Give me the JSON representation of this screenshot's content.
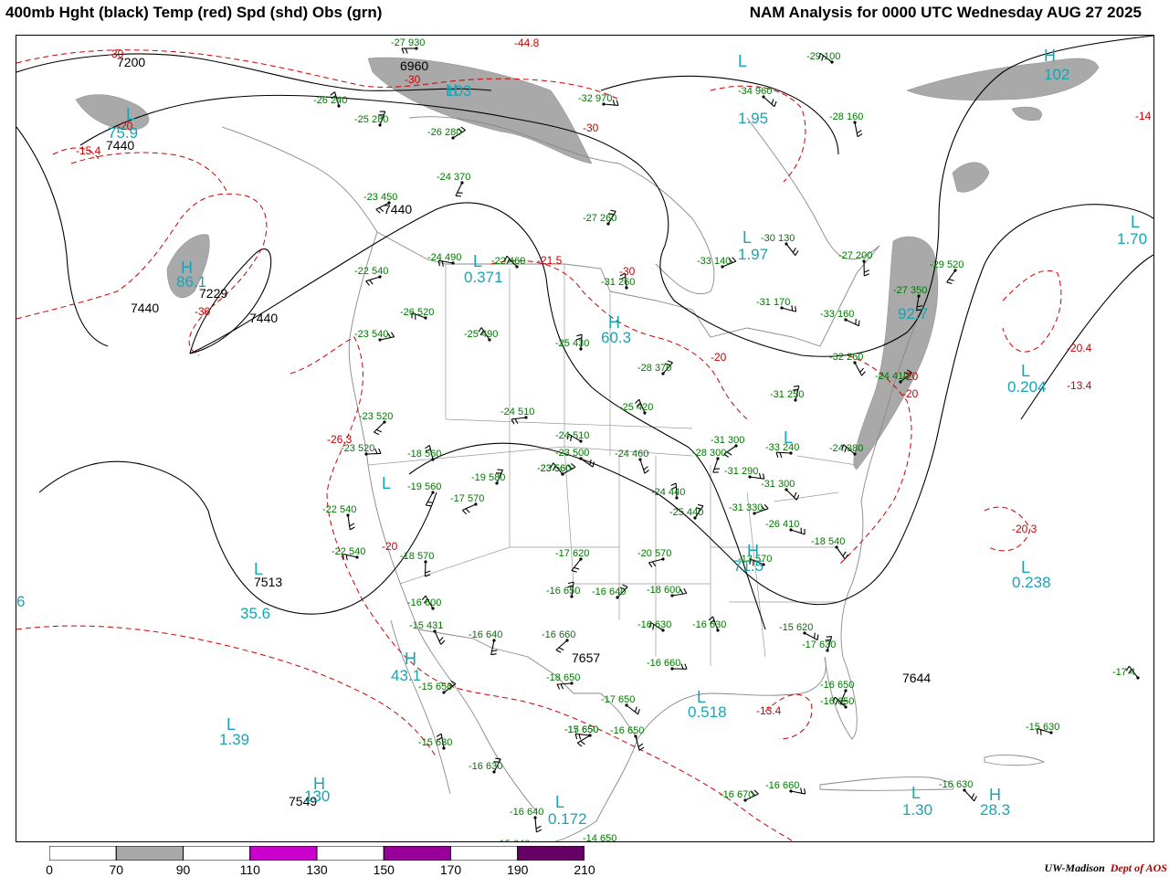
{
  "header": {
    "left": "400mb Hght (black) Temp (red) Spd (shd) Obs (grn)",
    "right": "NAM Analysis for 0000 UTC Wednesday  AUG 27 2025"
  },
  "colors": {
    "height": "#000000",
    "temperature": "#cc0000",
    "speed_label": "#1aa3b3",
    "obs": "#007700",
    "speed_70_90": "#a9a9a9",
    "speed_110_130": "#cc00cc",
    "speed_150_170": "#990099",
    "speed_190_210": "#660066",
    "borders": "#888888"
  },
  "colorbar": {
    "labels": [
      "0",
      "70",
      "90",
      "110",
      "130",
      "150",
      "170",
      "190",
      "210"
    ],
    "bins": [
      {
        "range": "0-70",
        "color": "#ffffff"
      },
      {
        "range": "70-90",
        "color": "#a9a9a9"
      },
      {
        "range": "90-110",
        "color": "#ffffff"
      },
      {
        "range": "110-130",
        "color": "#cc00cc"
      },
      {
        "range": "130-150",
        "color": "#ffffff"
      },
      {
        "range": "150-170",
        "color": "#990099"
      },
      {
        "range": "170-190",
        "color": "#ffffff"
      },
      {
        "range": "190-210",
        "color": "#660066"
      }
    ]
  },
  "height_labels": [
    "7200",
    "6960",
    "7440",
    "7440",
    "7440",
    "7440",
    "7229",
    "7513",
    "7657",
    "7644",
    "7549"
  ],
  "temp_labels": [
    "-30",
    "-44.8",
    "-30",
    "-20",
    "-15.4",
    "-30",
    "-30",
    "-20",
    "-21.5",
    "-20",
    "-30",
    "-26.3",
    "-20",
    "-20.4",
    "-13.4",
    "-20",
    "-20.3",
    "-13.4",
    "-14"
  ],
  "speed_labels": [
    "103",
    "1.95",
    "75.9",
    "102",
    "86.1",
    "0.371",
    "1.97",
    "60.3",
    "1.70",
    "92.7",
    "0.204",
    "0.238",
    "71.5",
    "35.6",
    "1.39",
    "43.1",
    "0.518",
    "1.30",
    "28.3",
    "0.172",
    "6",
    "130"
  ],
  "obs": [
    "-27 930",
    "-29 100",
    "-26 240",
    "-25 280",
    "-26 280",
    "-32 970",
    "-34 960",
    "-28 160",
    "-24 370",
    "-23 450",
    "-24 490",
    "-22 460",
    "-31 260",
    "-27 260",
    "-33 140",
    "-31 170",
    "-30 130",
    "-27 200",
    "-29 520",
    "-22 540",
    "-26 520",
    "-25 490",
    "-25 430",
    "-28 370",
    "-23 540",
    "-33 160",
    "-32 260",
    "-27 350",
    "-23 520",
    "-24 510",
    "-24 510",
    "-25 420",
    "-31 250",
    "-24 410",
    "-23 520",
    "-23 500",
    "-24 460",
    "-28 300",
    "-31 300",
    "-33 240",
    "-24 380",
    "-18 560",
    "-19 580",
    "-23 560",
    "-31 290",
    "-31 300",
    "-22 540",
    "-19 560",
    "-17 570",
    "-22 540",
    "-23 560",
    "-24 440",
    "-25 440",
    "-31 330",
    "-26 410",
    "-18 540",
    "-18 570",
    "-17 620",
    "-20 570",
    "-13 570",
    "-16 600",
    "-16 650",
    "-16 640",
    "-18 600",
    "-15 620",
    "-15 431",
    "-16 640",
    "-16 660",
    "-18 650",
    "-16 630",
    "-16 630",
    "-17 630",
    "-15 650",
    "-16 660",
    "-17 650",
    "-16 650",
    "-16 650",
    "-15 650",
    "-17 650",
    "-16 650",
    "-15 630",
    "-16 630",
    "-16 670",
    "-16 660",
    "-16 630",
    "-16 640",
    "-14 650",
    "-15 640",
    "-15 630",
    "-17 4"
  ],
  "credit": {
    "org": "UW-Madison",
    "dept": "Dept of AOS"
  }
}
